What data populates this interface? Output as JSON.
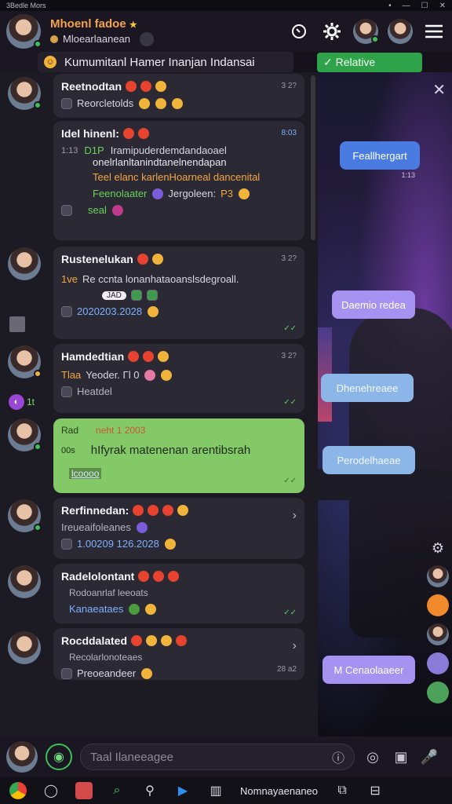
{
  "statusbar": {
    "title": "3Bedle Mors",
    "win_controls": [
      "•",
      "—",
      "☐",
      "✕"
    ]
  },
  "header": {
    "name": "Mhoenl fadoe",
    "star": "★",
    "subtitle": "Mloearlaanean",
    "icons": [
      "phone-search",
      "settings",
      "contact-avatar",
      "profile-avatar",
      "menu"
    ]
  },
  "banner": {
    "text": "Kumumitanl Hamer Inanjan Indansai",
    "smile": "☺"
  },
  "relative_button": {
    "label": "✓ Relative"
  },
  "right_panel": {
    "close": "✕",
    "bubbles": [
      {
        "text": "Feallhergart",
        "stamp": "1:13",
        "style": "blue"
      },
      {
        "text": "Daemio redea",
        "stamp": "",
        "style": "lav"
      },
      {
        "text": "Dhenehreaee",
        "stamp": "",
        "style": "light"
      },
      {
        "text": "Perodelhaeae",
        "stamp": "",
        "style": "light"
      },
      {
        "text": "M Cenaolaaeer",
        "stamp": "",
        "style": "lav"
      }
    ]
  },
  "messages": [
    {
      "name": "Reetnodtan",
      "time": "3 2?",
      "body": "Reorcletolds"
    },
    {
      "quote_header": "Idel hinenl:",
      "quote_time": "8:03",
      "left_time": "1:13",
      "line1": "D1P",
      "line1b": "Iramipuderdemdandaoael",
      "line2": "onelrlanltanindtanelnendapan",
      "line3": "Teel elanc karlenHoarneal dancenital",
      "line4a": "Feenolaater",
      "line4b": "Jergoleen:",
      "line4c": "P3",
      "line5": "seal"
    },
    {
      "name": "Rustenelukan",
      "time": "3 2?",
      "badge": "1ve",
      "body": "Re ccnta lonanhataoanslsdegroall.",
      "pill": "JAD",
      "date": "2020203.2028"
    },
    {
      "name": "Hamdedtian",
      "time": "3 2?",
      "badge": "Tlaa",
      "body": "Yeoder. Γl 0",
      "sub": "Heatdel"
    },
    {
      "sender": "Rad",
      "meta": "neht 1 2003",
      "left": "00s",
      "body": "hIfyrak matenenan arentibsrah",
      "link": "lcoooo"
    },
    {
      "name": "Rerfinnedan:",
      "body": "Ireueaifoleanes",
      "date": "1.00209 126.2028"
    },
    {
      "name": "Radelolontant",
      "body": "Rodoanrlaf leeoats",
      "sub": "Kanaeataes"
    },
    {
      "name": "Rocddalated",
      "body": "Recolarlonoteaes",
      "sub": "Preoeandeer",
      "time": "28 a2"
    }
  ],
  "side": {
    "count": "1t"
  },
  "composer": {
    "placeholder": "Taal Ilaneeagee"
  },
  "taskbar": {
    "label": "Nomnayaenaneo"
  }
}
